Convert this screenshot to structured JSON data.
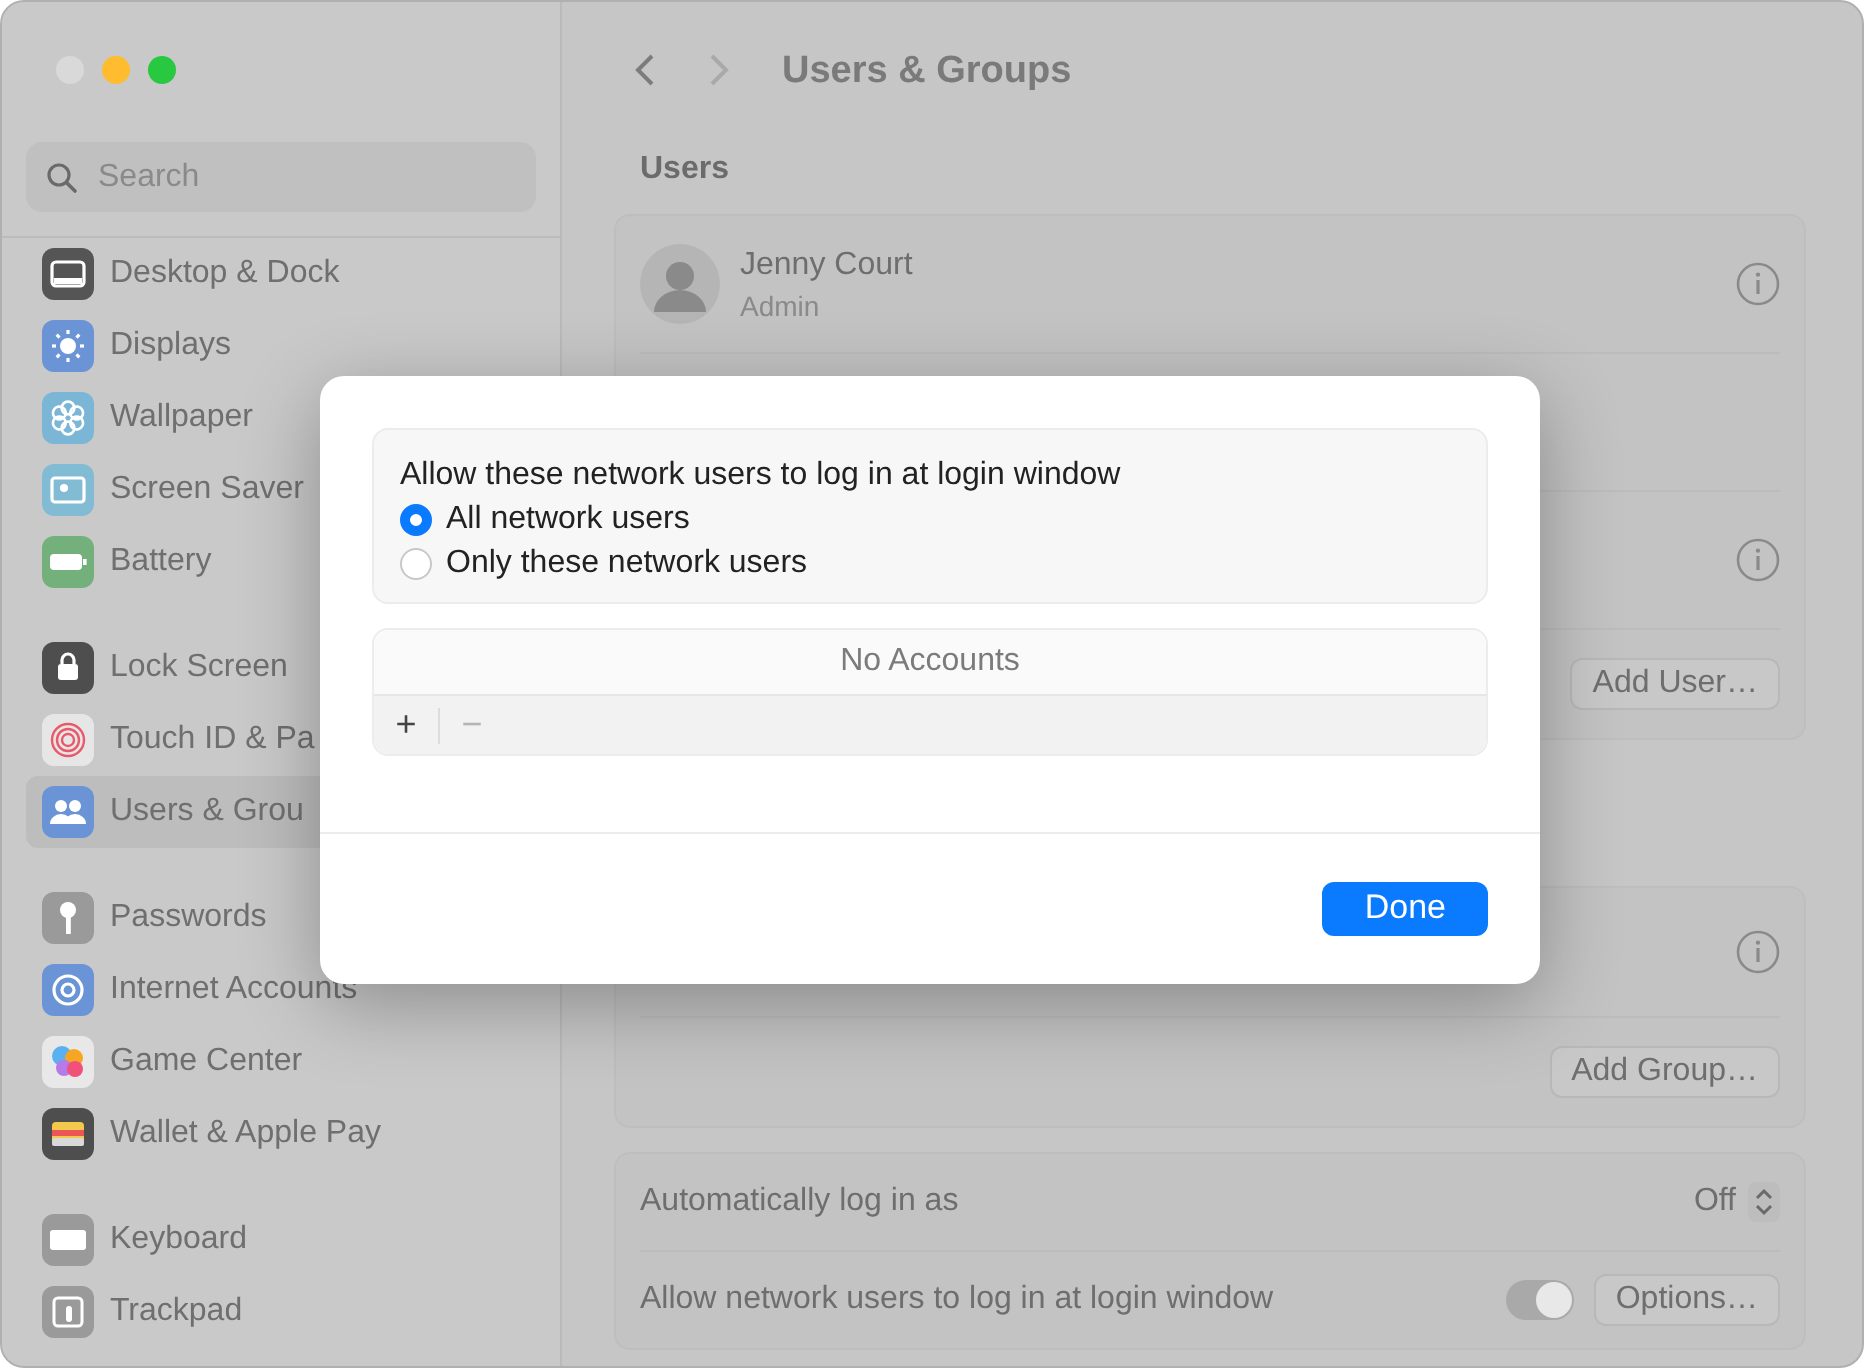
{
  "window": {
    "buttons": [
      {
        "kind": "close",
        "disabled": true
      },
      {
        "kind": "minimize",
        "disabled": false
      },
      {
        "kind": "zoom",
        "disabled": false
      }
    ]
  },
  "sidebar": {
    "search": {
      "placeholder": "Search"
    },
    "sections": [
      {
        "items": [
          {
            "label": "Desktop & Dock",
            "selected": false
          },
          {
            "label": "Displays",
            "selected": false
          },
          {
            "label": "Wallpaper",
            "selected": false
          },
          {
            "label": "Screen Saver",
            "selected": false
          },
          {
            "label": "Battery",
            "selected": false
          }
        ]
      },
      {
        "items": [
          {
            "label": "Lock Screen",
            "selected": false
          },
          {
            "label": "Touch ID & Pa",
            "selected": false
          },
          {
            "label": "Users & Grou",
            "selected": true
          }
        ]
      },
      {
        "items": [
          {
            "label": "Passwords",
            "selected": false
          },
          {
            "label": "Internet Accounts",
            "selected": false
          },
          {
            "label": "Game Center",
            "selected": false
          },
          {
            "label": "Wallet & Apple Pay",
            "selected": false
          }
        ]
      },
      {
        "items": [
          {
            "label": "Keyboard",
            "selected": false
          },
          {
            "label": "Trackpad",
            "selected": false
          }
        ]
      }
    ]
  },
  "toolbar": {
    "back": {
      "disabled": false
    },
    "forward": {
      "disabled": true
    },
    "title": "Users & Groups"
  },
  "users": {
    "heading": "Users",
    "rows": [
      {
        "kind": "user",
        "name": "Jenny Court",
        "role": "Admin"
      },
      {
        "kind": "covered"
      },
      {
        "kind": "info"
      }
    ],
    "button": "Add User…"
  },
  "groups": {
    "rows": [
      {
        "kind": "info"
      }
    ],
    "button": "Add Group…"
  },
  "login_options": [
    {
      "kind": "popup",
      "label": "Automatically log in as",
      "value": "Off"
    },
    {
      "kind": "toggle",
      "label": "Allow network users to log in at login window",
      "on": true,
      "button": "Options…"
    }
  ],
  "sheet": {
    "prompt": "Allow these network users to log in at login window",
    "options": [
      {
        "label": "All network users",
        "selected": true
      },
      {
        "label": "Only these network users",
        "selected": false
      }
    ],
    "list": {
      "empty_text": "No Accounts",
      "add": "+",
      "remove": "−",
      "remove_disabled": true
    },
    "done": "Done"
  }
}
